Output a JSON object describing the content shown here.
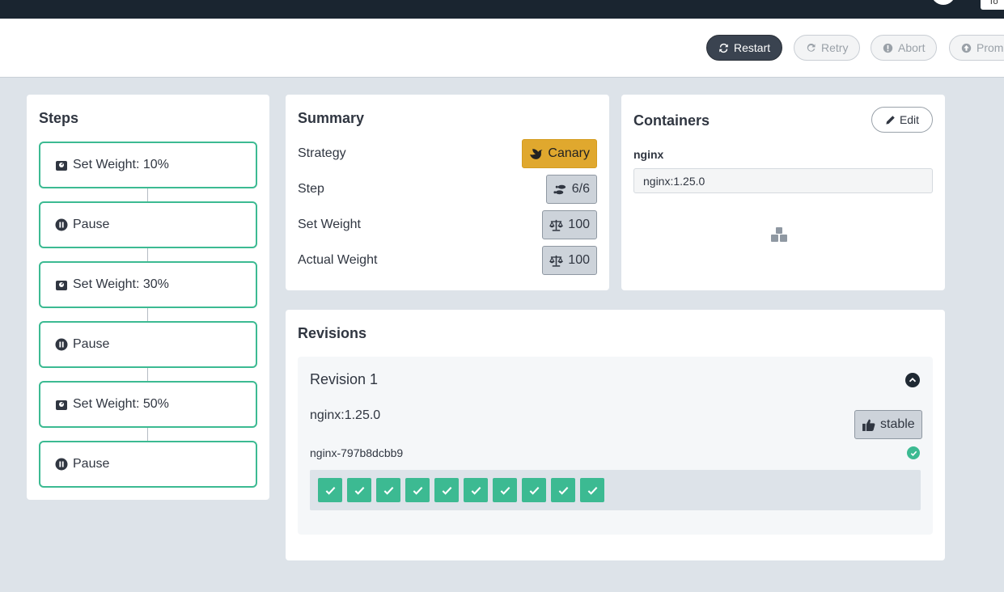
{
  "topbar": {
    "namespace": "To"
  },
  "toolbar": {
    "buttons": [
      {
        "label": "Restart",
        "icon": "refresh-icon",
        "primary": true
      },
      {
        "label": "Retry",
        "icon": "redo-icon",
        "primary": false
      },
      {
        "label": "Abort",
        "icon": "exclamation-circle-icon",
        "primary": false
      },
      {
        "label": "Prom",
        "icon": "arrow-circle-up-icon",
        "primary": false
      }
    ]
  },
  "steps": {
    "title": "Steps",
    "items": [
      {
        "label": "Set Weight: 10%",
        "icon": "weight-icon"
      },
      {
        "label": "Pause",
        "icon": "pause-circle-icon"
      },
      {
        "label": "Set Weight: 30%",
        "icon": "weight-icon"
      },
      {
        "label": "Pause",
        "icon": "pause-circle-icon"
      },
      {
        "label": "Set Weight: 50%",
        "icon": "weight-icon"
      },
      {
        "label": "Pause",
        "icon": "pause-circle-icon"
      }
    ]
  },
  "summary": {
    "title": "Summary",
    "rows": [
      {
        "label": "Strategy",
        "value": "Canary",
        "icon": "dove-icon",
        "accent": "#e0a82e"
      },
      {
        "label": "Step",
        "value": "6/6",
        "icon": "shoe-prints-icon"
      },
      {
        "label": "Set Weight",
        "value": "100",
        "icon": "balance-scale-icon"
      },
      {
        "label": "Actual Weight",
        "value": "100",
        "icon": "balance-scale-icon"
      }
    ]
  },
  "containers": {
    "title": "Containers",
    "edit_label": "Edit",
    "name": "nginx",
    "image": "nginx:1.25.0"
  },
  "revisions": {
    "title": "Revisions",
    "revision": {
      "title": "Revision 1",
      "image": "nginx:1.25.0",
      "badge": "stable",
      "replicaset": "nginx-797b8dcbb9",
      "pod_count": 10
    }
  },
  "colors": {
    "accent": "#3cba92",
    "canary": "#e0a82e",
    "dark": "#1a2530"
  }
}
